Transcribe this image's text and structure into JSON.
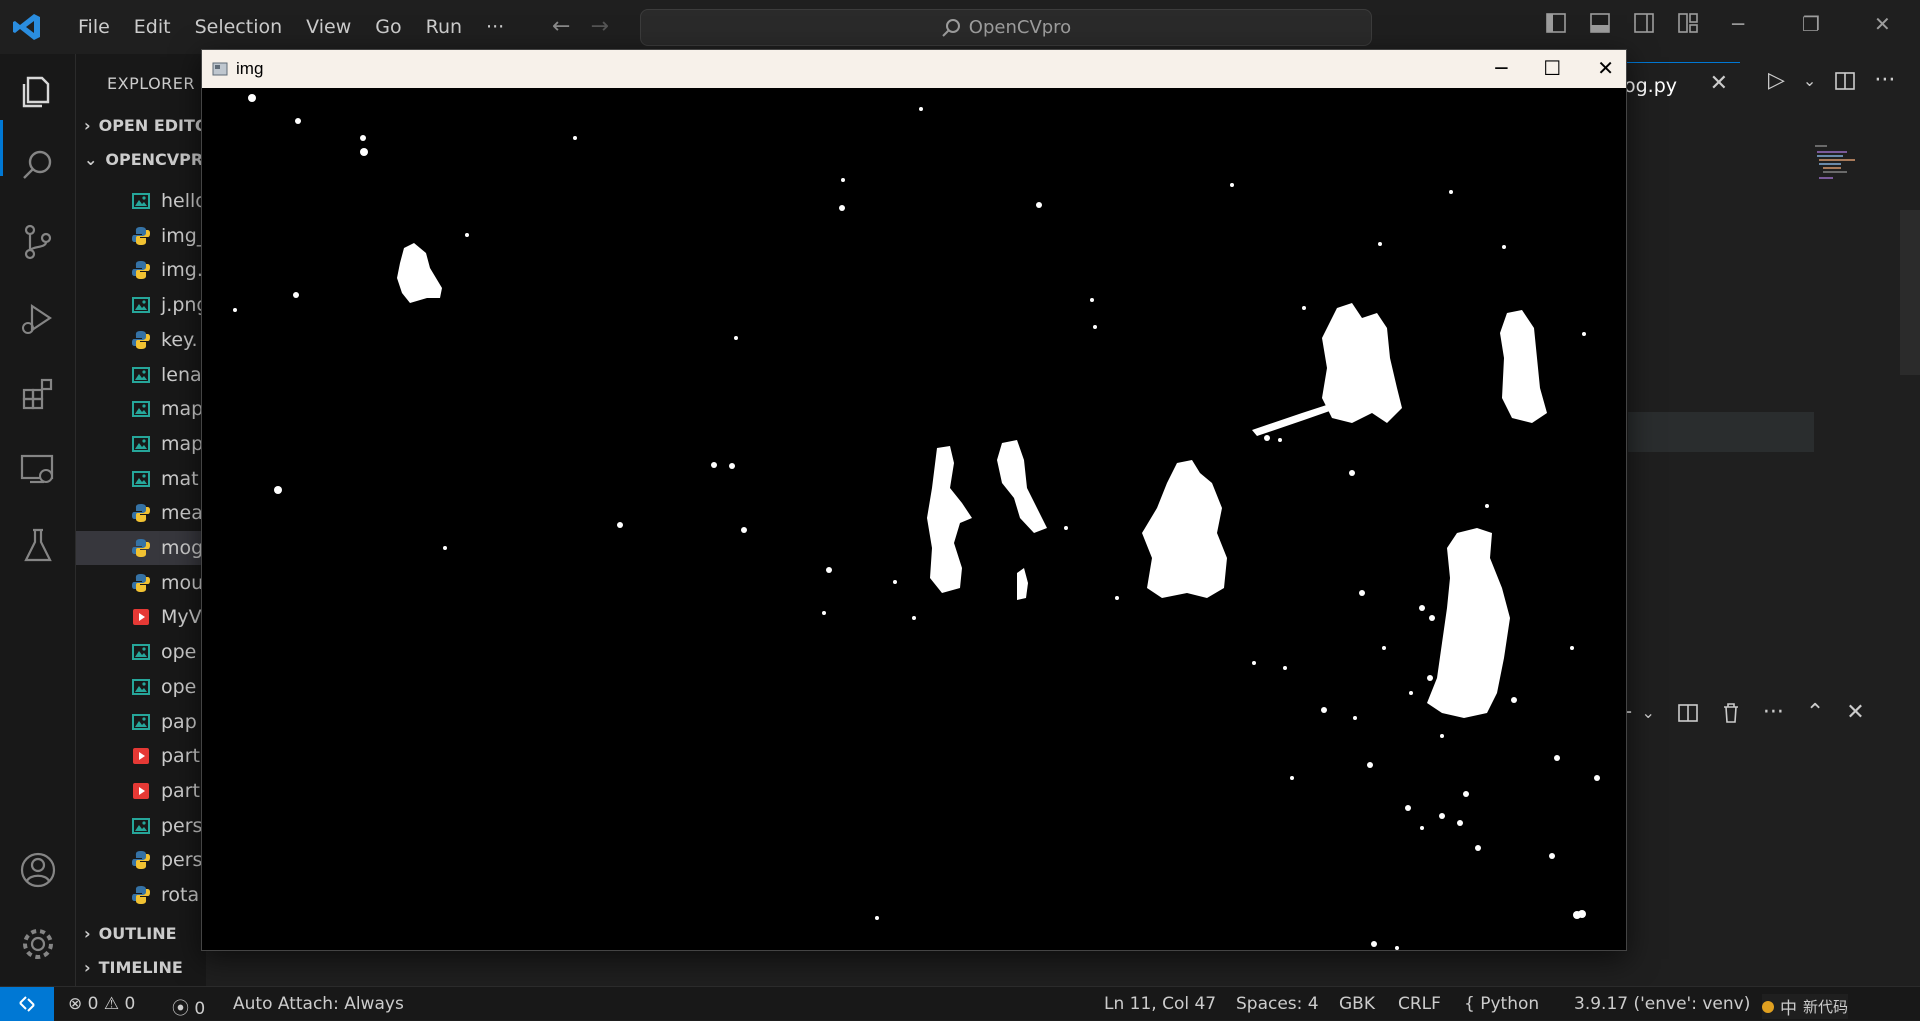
{
  "titlebar": {
    "menus": [
      "File",
      "Edit",
      "Selection",
      "View",
      "Go",
      "Run",
      "···"
    ],
    "command_center": "OpenCVpro"
  },
  "sidebar": {
    "title": "EXPLORER",
    "open_editors": "OPEN EDITORS",
    "project": "OPENCVPRO",
    "files": [
      {
        "name": "hello",
        "type": "image"
      },
      {
        "name": "img_",
        "type": "python"
      },
      {
        "name": "img.",
        "type": "python"
      },
      {
        "name": "j.png",
        "type": "image"
      },
      {
        "name": "key.",
        "type": "python"
      },
      {
        "name": "lena",
        "type": "image"
      },
      {
        "name": "map",
        "type": "image"
      },
      {
        "name": "map",
        "type": "image"
      },
      {
        "name": "mat",
        "type": "image"
      },
      {
        "name": "mea",
        "type": "python"
      },
      {
        "name": "mog",
        "type": "python"
      },
      {
        "name": "mou",
        "type": "python"
      },
      {
        "name": "MyV",
        "type": "video"
      },
      {
        "name": "ope",
        "type": "image"
      },
      {
        "name": "ope",
        "type": "image"
      },
      {
        "name": "pap",
        "type": "image"
      },
      {
        "name": "part",
        "type": "video"
      },
      {
        "name": "part",
        "type": "video"
      },
      {
        "name": "pers",
        "type": "image"
      },
      {
        "name": "pers",
        "type": "python"
      },
      {
        "name": "rota",
        "type": "python"
      }
    ],
    "outline": "OUTLINE",
    "timeline": "TIMELINE"
  },
  "editor": {
    "tab_label": "og.py"
  },
  "opencv_window": {
    "title": "img"
  },
  "statusbar": {
    "errors": "0",
    "warnings": "0",
    "ports": "0",
    "auto_attach": "Auto Attach: Always",
    "position": "Ln 11, Col 47",
    "spaces": "Spaces: 4",
    "encoding": "GBK",
    "eol": "CRLF",
    "language": "Python",
    "interpreter": "3.9.17 ('enve': venv)",
    "ime": "中",
    "extra": "新代码"
  },
  "colors": {
    "accent": "#0078d4",
    "python_icon": "#3572A5",
    "image_icon": "#26a69a",
    "video_icon": "#e53935"
  }
}
